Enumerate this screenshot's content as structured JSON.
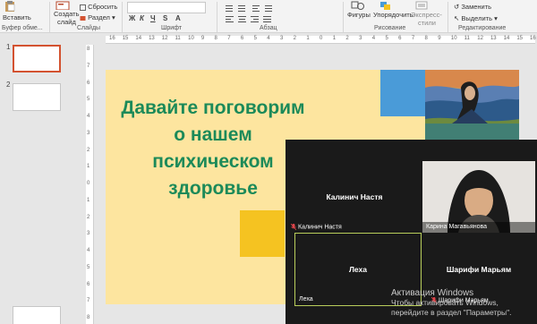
{
  "ribbon": {
    "paste": "Вставить",
    "clipboard_group": "Буфер обме...",
    "create_slide": "Создать",
    "create_slide_2": "слайд",
    "reset": "Сбросить",
    "section": "Раздел",
    "slides_group": "Слайды",
    "font_group": "Шрифт",
    "paragraph_group": "Абзац",
    "shapes": "Фигуры",
    "arrange": "Упорядочить",
    "express_styles": "Экспресс-",
    "express_styles_2": "стили",
    "drawing_group": "Рисование",
    "replace": "Заменить",
    "select": "Выделить",
    "editing_group": "Редактирование"
  },
  "thumbnails": [
    {
      "number": "1"
    },
    {
      "number": "2"
    }
  ],
  "ruler": {
    "horizontal_ticks": [
      "16",
      "15",
      "14",
      "13",
      "12",
      "11",
      "10",
      "9",
      "8",
      "7",
      "6",
      "5",
      "4",
      "3",
      "2",
      "1",
      "0",
      "1",
      "2",
      "3",
      "4",
      "5",
      "6",
      "7",
      "8",
      "9",
      "10",
      "11",
      "12",
      "13",
      "14",
      "15",
      "16"
    ],
    "vertical_ticks": [
      "8",
      "7",
      "6",
      "5",
      "4",
      "3",
      "2",
      "1",
      "0",
      "1",
      "2",
      "3",
      "4",
      "5",
      "6",
      "7",
      "8"
    ]
  },
  "slide": {
    "title_line1": "Давайте поговорим",
    "title_line2": "о нашем",
    "title_line3": "психическом",
    "title_line4": "здоровье",
    "title_color": "#1c8a59",
    "background": "#fde59f"
  },
  "video_call": {
    "tiles": [
      {
        "big_name": "Калинич Настя",
        "small_name": "Калинич Настя",
        "muted": true
      },
      {
        "big_name": "",
        "small_name": "Карина Магавьянова",
        "muted": false
      },
      {
        "big_name": "Леха",
        "small_name": "Леха",
        "muted": false
      },
      {
        "big_name": "Шарифи Марьям",
        "small_name": "Шарифи Марьям",
        "muted": true
      }
    ],
    "active_speaker_color": "#b9ce5b"
  },
  "activation": {
    "line1": "Активация Windows",
    "line2": "Чтобы активировать Windows,",
    "line3": "перейдите в раздел \"Параметры\"."
  }
}
